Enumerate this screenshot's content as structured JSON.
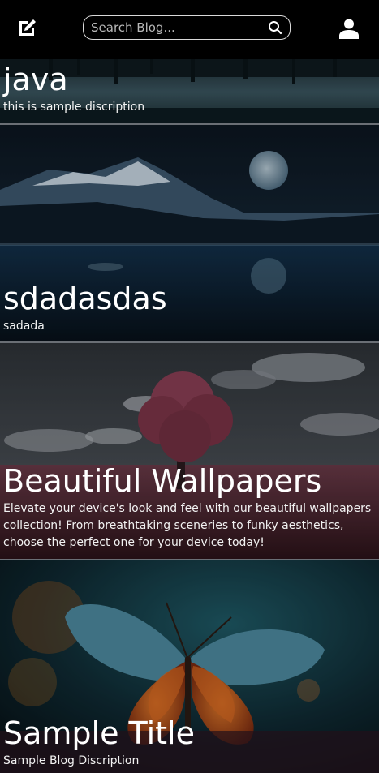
{
  "header": {
    "edit_icon": "edit-square-icon",
    "search": {
      "placeholder": "Search Blog...",
      "value": "",
      "icon": "search-icon"
    },
    "profile_icon": "user-icon"
  },
  "posts": [
    {
      "title": "java",
      "description": "this is sample discription",
      "image": "lake-reflection"
    },
    {
      "title": "sdadasdas",
      "description": "sadada",
      "image": "moonlit-lake"
    },
    {
      "title": "Beautiful Wallpapers",
      "description": "Elevate your device's look and feel with our beautiful wallpapers collection! From breathtaking sceneries to funky aesthetics, choose the perfect one for your device today!",
      "image": "red-tree-field"
    },
    {
      "title": "Sample Title",
      "description": "Sample Blog Discription",
      "image": "butterfly"
    }
  ],
  "colors": {
    "background": "#000000",
    "divider": "#6a6f75",
    "search_border": "#d9d9d9"
  }
}
